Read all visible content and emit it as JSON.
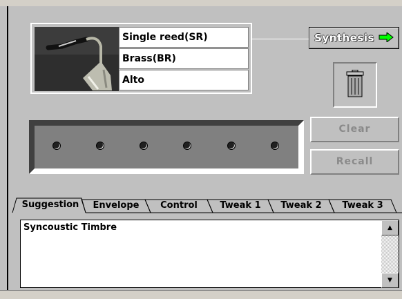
{
  "instrument": {
    "labels": [
      "Single reed(SR)",
      "Brass(BR)",
      "Alto"
    ]
  },
  "buttons": {
    "synthesis": "Synthesis",
    "clear": "Clear",
    "recall": "Recall"
  },
  "tabs": [
    "Suggestion",
    "Envelope",
    "Control",
    "Tweak 1",
    "Tweak 2",
    "Tweak 3"
  ],
  "text_area": {
    "content": "Syncoustic Timbre"
  },
  "colors": {
    "arrow": "#00ff00",
    "panel": "#c0c0c0",
    "disabled_text": "#8a8a8a"
  },
  "icons": {
    "synthesis": "green-right-arrow",
    "trash": "trash-can"
  }
}
